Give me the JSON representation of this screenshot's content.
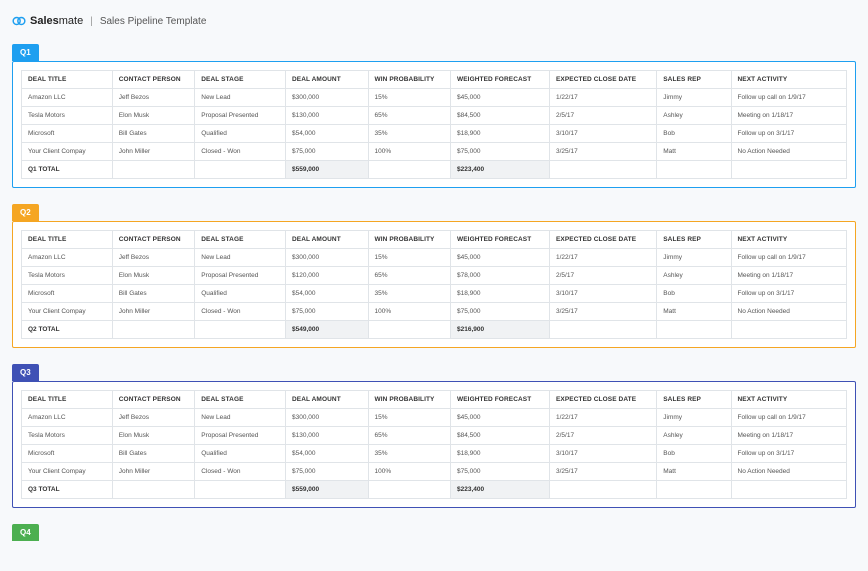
{
  "header": {
    "brand_primary": "Sales",
    "brand_secondary": "mate",
    "title": "Sales Pipeline Template"
  },
  "columns": [
    "DEAL TITLE",
    "CONTACT PERSON",
    "DEAL STAGE",
    "DEAL AMOUNT",
    "WIN PROBABILITY",
    "WEIGHTED FORECAST",
    "EXPECTED CLOSE DATE",
    "SALES REP",
    "NEXT ACTIVITY"
  ],
  "quarters": [
    {
      "id": "Q1",
      "class": "q1",
      "rows": [
        [
          "Amazon LLC",
          "Jeff Bezos",
          "New Lead",
          "$300,000",
          "15%",
          "$45,000",
          "1/22/17",
          "Jimmy",
          "Follow up call on 1/9/17"
        ],
        [
          "Tesla Motors",
          "Elon Musk",
          "Proposal Presented",
          "$130,000",
          "65%",
          "$84,500",
          "2/5/17",
          "Ashley",
          "Meeting on 1/18/17"
        ],
        [
          "Microsoft",
          "Bill Gates",
          "Qualified",
          "$54,000",
          "35%",
          "$18,900",
          "3/10/17",
          "Bob",
          "Follow up on 3/1/17"
        ],
        [
          "Your Client Compay",
          "John Miller",
          "Closed - Won",
          "$75,000",
          "100%",
          "$75,000",
          "3/25/17",
          "Matt",
          "No Action Needed"
        ]
      ],
      "total_label": "Q1 TOTAL",
      "total_amount": "$559,000",
      "total_forecast": "$223,400"
    },
    {
      "id": "Q2",
      "class": "q2",
      "rows": [
        [
          "Amazon LLC",
          "Jeff Bezos",
          "New Lead",
          "$300,000",
          "15%",
          "$45,000",
          "1/22/17",
          "Jimmy",
          "Follow up call on 1/9/17"
        ],
        [
          "Tesla Motors",
          "Elon Musk",
          "Proposal Presented",
          "$120,000",
          "65%",
          "$78,000",
          "2/5/17",
          "Ashley",
          "Meeting on 1/18/17"
        ],
        [
          "Microsoft",
          "Bill Gates",
          "Qualified",
          "$54,000",
          "35%",
          "$18,900",
          "3/10/17",
          "Bob",
          "Follow up on 3/1/17"
        ],
        [
          "Your Client Compay",
          "John Miller",
          "Closed - Won",
          "$75,000",
          "100%",
          "$75,000",
          "3/25/17",
          "Matt",
          "No Action Needed"
        ]
      ],
      "total_label": "Q2 TOTAL",
      "total_amount": "$549,000",
      "total_forecast": "$216,900"
    },
    {
      "id": "Q3",
      "class": "q3",
      "rows": [
        [
          "Amazon LLC",
          "Jeff Bezos",
          "New Lead",
          "$300,000",
          "15%",
          "$45,000",
          "1/22/17",
          "Jimmy",
          "Follow up call on 1/9/17"
        ],
        [
          "Tesla Motors",
          "Elon Musk",
          "Proposal Presented",
          "$130,000",
          "65%",
          "$84,500",
          "2/5/17",
          "Ashley",
          "Meeting on 1/18/17"
        ],
        [
          "Microsoft",
          "Bill Gates",
          "Qualified",
          "$54,000",
          "35%",
          "$18,900",
          "3/10/17",
          "Bob",
          "Follow up on 3/1/17"
        ],
        [
          "Your Client Compay",
          "John Miller",
          "Closed - Won",
          "$75,000",
          "100%",
          "$75,000",
          "3/25/17",
          "Matt",
          "No Action Needed"
        ]
      ],
      "total_label": "Q3 TOTAL",
      "total_amount": "$559,000",
      "total_forecast": "$223,400"
    }
  ],
  "q4_label": "Q4"
}
